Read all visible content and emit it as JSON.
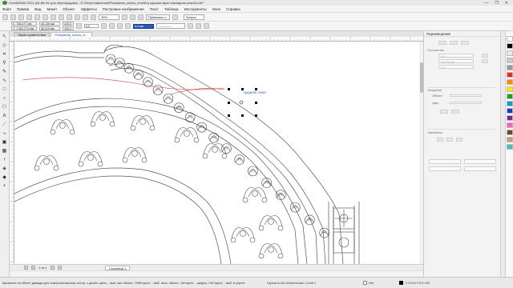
{
  "window": {
    "title": "CorelDRAW 2021 (64-Bit Не для перепродажи) - D:\\Переплавления\\Резервная_копия_столбец царских врат накладная резьба.cdr*",
    "controls": [
      "—",
      "❐",
      "✕"
    ]
  },
  "menu": [
    "Файл",
    "Правка",
    "Вид",
    "Макет",
    "Объект",
    "Эффекты",
    "Растровые изображения",
    "Текст",
    "Таблица",
    "Инструменты",
    "Окно",
    "Справка"
  ],
  "stdbar": {
    "zoom": "49%",
    "launch_label": "Запуск",
    "snap_label": "Привязать к"
  },
  "propbar": {
    "x": "X: 768,677 мм",
    "y": "Y: 1 361,274 мм",
    "w": "45,106 мм",
    "h": "46,415 мм",
    "scale_w": "100,0",
    "scale_h": "100,0",
    "angle": "0,0",
    "selected_field": "0,0 мм"
  },
  "tabs": {
    "welcome": "Экран приветствия",
    "document": "Резервная_копия_ст..."
  },
  "canvas": {
    "tooltip": "средняя точка"
  },
  "pagebar": {
    "page_info": "1 из 1",
    "page_tab": "Страница 1"
  },
  "status": {
    "hint": "Щелкните на объект дважды для поворота/наклона; инстр. с двойн. щелч. - выб. все объект.; Shift+щелч. - выб. неск. объект.; Alt+щелч. - цифры; Ctrl+щелч. - выб. в группе",
    "object_info": "Группа из 60 объектов вкл. Слой 1",
    "fill_label": "Нет",
    "outline_info": "C:0 M:0 Y:0 K:100"
  },
  "docker": {
    "title": "Перемещение",
    "sections": {
      "position": "Положение",
      "acceleration": "Ускорение",
      "object_label": "Объект",
      "color_label": "Цвет",
      "smoothing": "Смесьпеть"
    },
    "values": {
      "pos_x": "0,0",
      "pos_y": "45,254 мм",
      "pos_z": "0,0"
    }
  },
  "palette": {
    "colors": [
      "#ffffff",
      "#000000",
      "#e8e8e8",
      "#c8c8c8",
      "#9a9a9a",
      "#ff2020",
      "#ff8a00",
      "#ffe800",
      "#20a020",
      "#00a0e0",
      "#1040c0",
      "#8020a0",
      "#ff60c0",
      "#804020",
      "#c0a070",
      "#40c0c0"
    ]
  }
}
